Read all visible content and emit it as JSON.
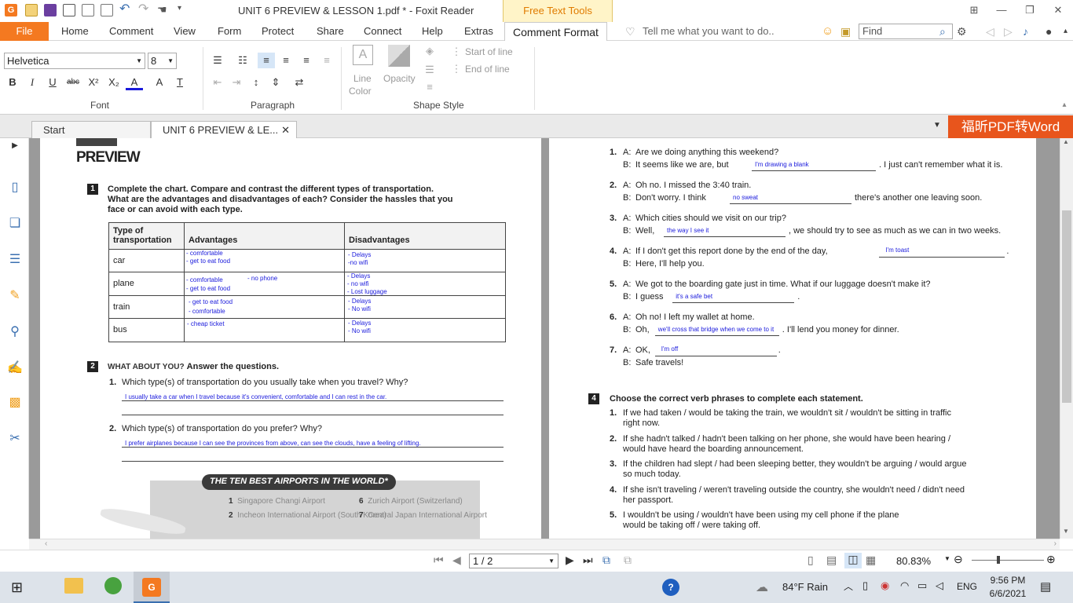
{
  "window": {
    "title": "UNIT 6 PREVIEW & LESSON 1.pdf * - Foxit Reader",
    "context_tab": "Free Text Tools"
  },
  "menu": {
    "file": "File",
    "items": [
      "Home",
      "Comment",
      "View",
      "Form",
      "Protect",
      "Share",
      "Connect",
      "Help",
      "Extras"
    ],
    "active": "Comment Format",
    "tell_me": "Tell me what you want to do..",
    "find_placeholder": "Find"
  },
  "ribbon": {
    "font_name": "Helvetica",
    "font_size": "8",
    "groups": {
      "font": "Font",
      "paragraph": "Paragraph",
      "shape": "Shape Style"
    },
    "line_color": "Line",
    "line_color2": "Color",
    "opacity": "Opacity",
    "start_of_line": "Start of line",
    "end_of_line": "End of line"
  },
  "tabs": {
    "start": "Start",
    "doc": "UNIT 6 PREVIEW & LE...",
    "promo": "福昕PDF转Word"
  },
  "left_page": {
    "heading": "PREVIEW",
    "ex1_num": "1",
    "ex1_l1": "Complete the chart. Compare and contrast the different types of transportation.",
    "ex1_l2": "What are the advantages and disadvantages of each? Consider the hassles that you",
    "ex1_l3": "face or can avoid with each type.",
    "col1a": "Type of",
    "col1b": "transportation",
    "col2": "Advantages",
    "col3": "Disadvantages",
    "rows": [
      {
        "type": "car",
        "adv1": "- comfortable",
        "adv2": "- get to eat food",
        "dis1": "- Delays",
        "dis2": "-no wifi"
      },
      {
        "type": "plane",
        "adv1": "- comfortable",
        "adv2": "- get to eat food",
        "adv3": "- no phone",
        "dis1": "- Delays",
        "dis2": "- no wifi",
        "dis3": "- Lost luggage"
      },
      {
        "type": "train",
        "adv1": "- get to eat food",
        "adv2": "- comfortable",
        "dis1": "- Delays",
        "dis2": "- No wifi"
      },
      {
        "type": "bus",
        "adv1": "- cheap ticket",
        "dis1": "- Delays",
        "dis2": "- No wifi"
      }
    ],
    "ex2_num": "2",
    "ex2_head": "WHAT ABOUT YOU?",
    "ex2_tail": "Answer the questions.",
    "q1": "1.",
    "q1_text": "Which type(s) of transportation do you usually take when you travel? Why?",
    "a1": "I usually take a car when I travel because it's convenient, comfortable and I can rest in the car.",
    "q2": "2.",
    "q2_text": "Which type(s) of transportation do you prefer? Why?",
    "a2": "I prefer airplanes because I can see the provinces from above, can see the clouds, have a feeling of lifting.",
    "banner": "THE TEN BEST AIRPORTS IN THE WORLD*",
    "airports": [
      {
        "n": "1",
        "name": "Singapore Changi Airport"
      },
      {
        "n": "2",
        "name": "Incheon International Airport (South Korea)"
      },
      {
        "n": "6",
        "name": "Zurich Airport (Switzerland)"
      },
      {
        "n": "7",
        "name": "Central Japan International Airport"
      }
    ]
  },
  "right_page": {
    "dialogs": [
      {
        "n": "1.",
        "a": "Are we doing anything this weekend?",
        "b1": "It seems like we are, but",
        "fill": "I'm drawing a blank",
        "b2": ". I just can't remember what it is."
      },
      {
        "n": "2.",
        "a": "Oh no. I missed the 3:40 train.",
        "b1": "Don't worry. I think",
        "fill": "no sweat",
        "b2": "there's another one leaving soon."
      },
      {
        "n": "3.",
        "a": "Which cities should we visit on our trip?",
        "b1": "Well,",
        "fill": "the way I see it",
        "b2": ", we should try to see as much as we can in two weeks."
      },
      {
        "n": "4.",
        "a": "If I don't get this report done by the end of the day,",
        "fill": "I'm toast",
        "a2": ".",
        "b1": "Here, I'll help you."
      },
      {
        "n": "5.",
        "a": "We got to the boarding gate just in time. What if our luggage doesn't make it?",
        "b1": "I guess",
        "fill": "it's a safe bet",
        "b2": "."
      },
      {
        "n": "6.",
        "a": "Oh no! I left my wallet at home.",
        "b1": "Oh,",
        "fill": "we'll cross that bridge when we come to it",
        "b2": ". I'll lend you money for dinner."
      },
      {
        "n": "7.",
        "a": "OK,",
        "fill": "I'm off",
        "a2": ".",
        "b1": "Safe travels!"
      }
    ],
    "labelA": "A:",
    "labelB": "B:",
    "ex4_num": "4",
    "ex4_title": "Choose the correct verb phrases to complete each statement.",
    "statements": [
      {
        "n": "1.",
        "l1": "If we had taken / would be taking the train, we wouldn't sit / wouldn't be sitting in traffic",
        "l2": "right now."
      },
      {
        "n": "2.",
        "l1": "If she hadn't talked / hadn't been talking on her phone, she would have been hearing /",
        "l2": "would have heard the boarding announcement."
      },
      {
        "n": "3.",
        "l1": "If the children had slept / had been sleeping better, they wouldn't be arguing / would argue",
        "l2": "so much today."
      },
      {
        "n": "4.",
        "l1": "If she isn't traveling / weren't traveling outside the country, she wouldn't need / didn't need",
        "l2": "her passport."
      },
      {
        "n": "5.",
        "l1": "I wouldn't be using / wouldn't have been using my cell phone if the plane",
        "l2": "would be taking off / were taking off."
      }
    ]
  },
  "status": {
    "page": "1 / 2",
    "zoom": "80.83%"
  },
  "taskbar": {
    "weather": "84°F  Rain",
    "lang": "ENG",
    "time": "9:56 PM",
    "date": "6/6/2021"
  }
}
